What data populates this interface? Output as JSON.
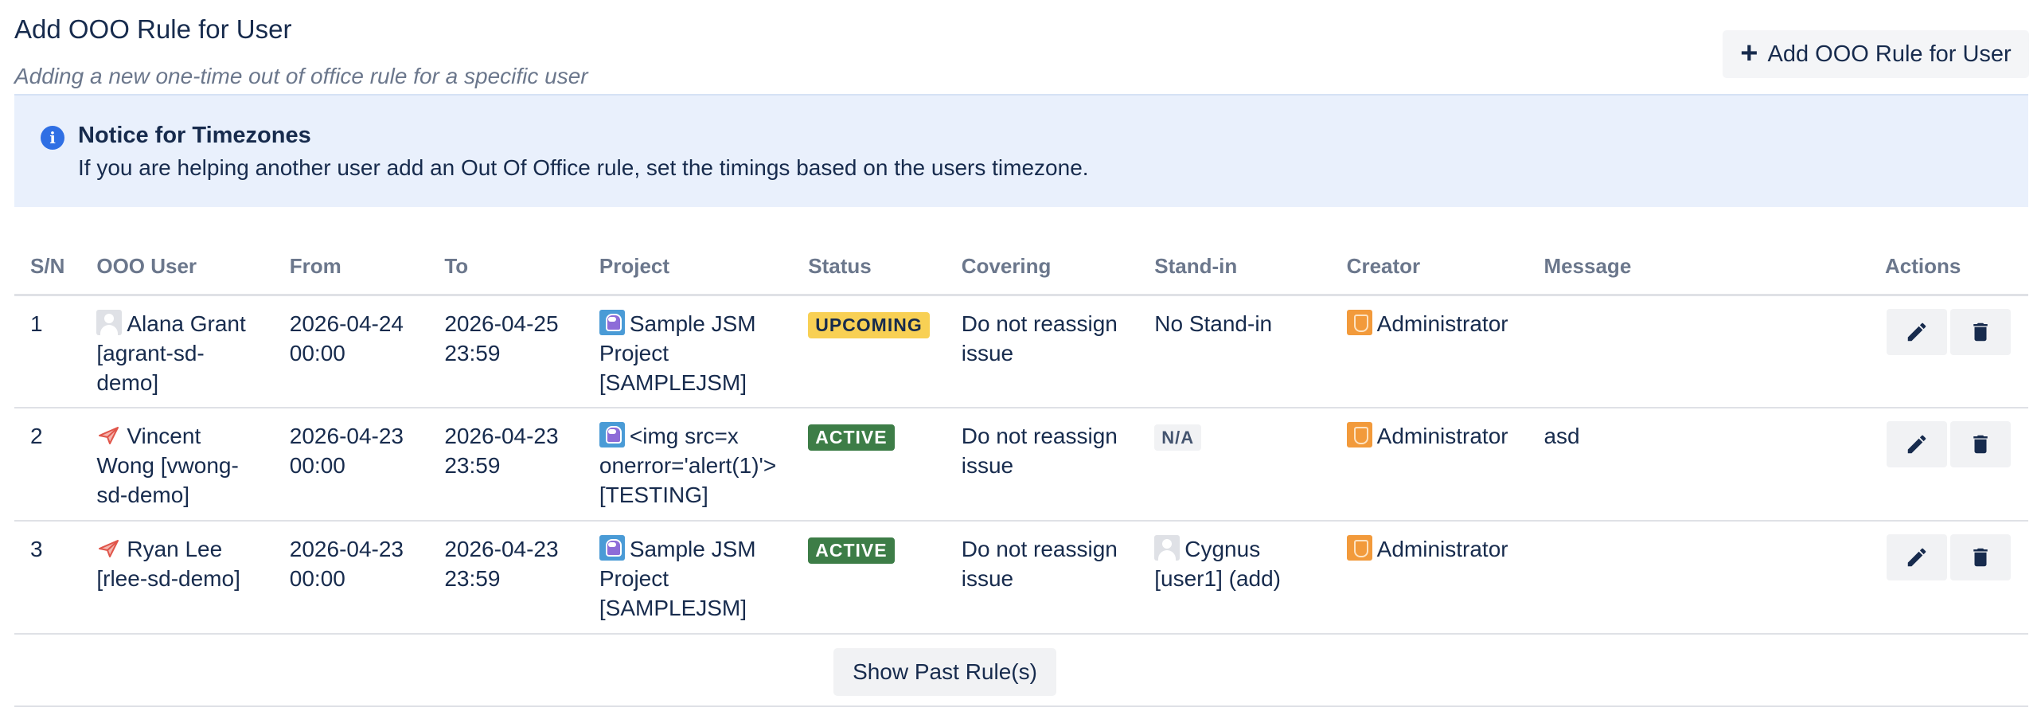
{
  "header": {
    "title": "Add OOO Rule for User",
    "subtitle": "Adding a new one-time out of office rule for a specific user",
    "add_button_label": "Add OOO Rule for User"
  },
  "notice": {
    "icon": "info-icon",
    "title": "Notice for Timezones",
    "text": "If you are helping another user add an Out Of Office rule, set the timings based on the users timezone."
  },
  "table": {
    "columns": [
      "S/N",
      "OOO User",
      "From",
      "To",
      "Project",
      "Status",
      "Covering",
      "Stand-in",
      "Creator",
      "Message",
      "Actions"
    ],
    "rows": [
      {
        "sn": "1",
        "user": "Alana Grant [agrant-sd-demo]",
        "user_avatar": "default-avatar",
        "from": "2026-04-24 00:00",
        "to": "2026-04-25 23:59",
        "project": "Sample JSM Project [SAMPLEJSM]",
        "status": "UPCOMING",
        "covering": "Do not reassign issue",
        "standin": "No Stand-in",
        "creator": "Administrator",
        "message": ""
      },
      {
        "sn": "2",
        "user": "Vincent Wong [vwong-sd-demo]",
        "user_avatar": "paper-plane-avatar",
        "from": "2026-04-23 00:00",
        "to": "2026-04-23 23:59",
        "project": "<img src=x onerror='alert(1)'> [TESTING]",
        "status": "ACTIVE",
        "covering": "Do not reassign issue",
        "standin": "N/A",
        "creator": "Administrator",
        "message": "asd"
      },
      {
        "sn": "3",
        "user": "Ryan Lee [rlee-sd-demo]",
        "user_avatar": "paper-plane-avatar",
        "from": "2026-04-23 00:00",
        "to": "2026-04-23 23:59",
        "project": "Sample JSM Project [SAMPLEJSM]",
        "status": "ACTIVE",
        "covering": "Do not reassign issue",
        "standin": "Cygnus [user1] (add)",
        "creator": "Administrator",
        "message": ""
      }
    ]
  },
  "show_past_label": "Show Past Rule(s)",
  "colors": {
    "notice_bg": "#e9f0fc",
    "info_blue": "#2f6fe4",
    "upcoming": "#f8d054",
    "active": "#3d7d47"
  }
}
